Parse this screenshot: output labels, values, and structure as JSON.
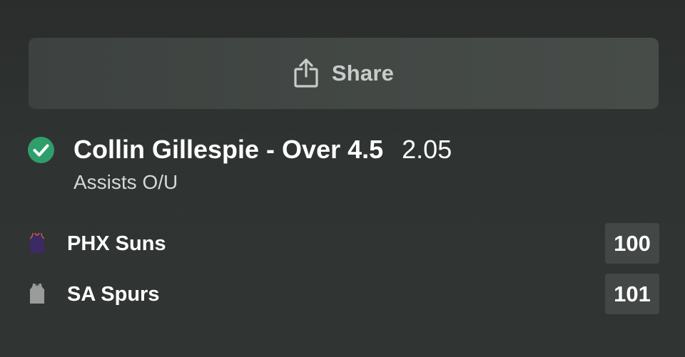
{
  "share": {
    "label": "Share",
    "icon": "share-icon"
  },
  "selection": {
    "status_icon": "check-circle-icon",
    "status_color": "#2f9e6b",
    "name": "Collin Gillespie - Over 4.5",
    "odds": "2.05",
    "market": "Assists O/U"
  },
  "teams": [
    {
      "name": "PHX Suns",
      "score": "100",
      "icon": "jersey-icon",
      "jersey_color": "#3b2a63"
    },
    {
      "name": "SA Spurs",
      "score": "101",
      "icon": "jersey-icon",
      "jersey_color": "#9a9c9b"
    }
  ]
}
